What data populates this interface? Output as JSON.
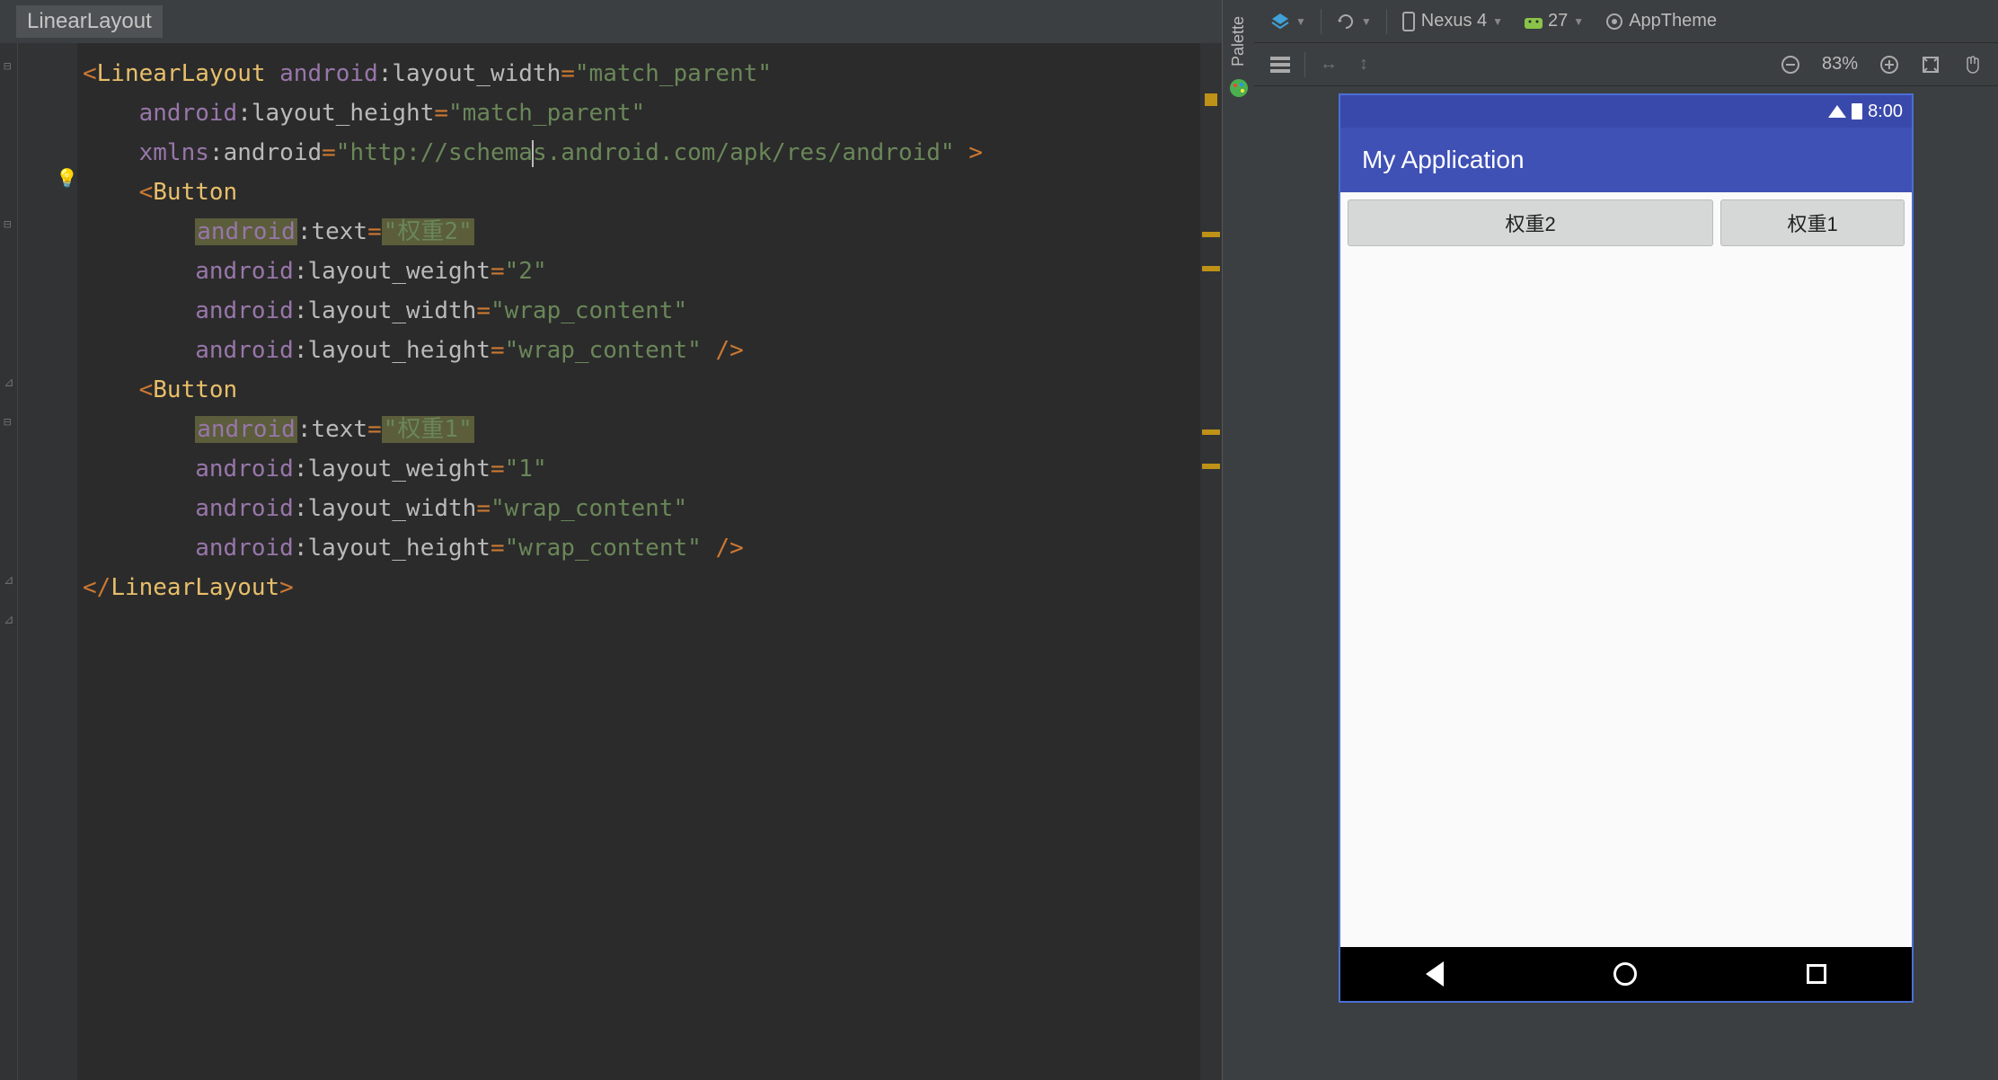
{
  "breadcrumb": {
    "item": "LinearLayout"
  },
  "code": {
    "root_tag": "LinearLayout",
    "attrs": {
      "layout_width": {
        "ns": "android",
        "name": "layout_width",
        "value": "match_parent"
      },
      "layout_height": {
        "ns": "android",
        "name": "layout_height",
        "value": "match_parent"
      },
      "xmlns": {
        "ns": "xmlns",
        "name": "android",
        "value": "http://schemas.android.com/apk/res/android"
      }
    },
    "button1": {
      "tag": "Button",
      "text": {
        "ns": "android",
        "name": "text",
        "value": "权重2"
      },
      "weight": {
        "ns": "android",
        "name": "layout_weight",
        "value": "2"
      },
      "width": {
        "ns": "android",
        "name": "layout_width",
        "value": "wrap_content"
      },
      "height": {
        "ns": "android",
        "name": "layout_height",
        "value": "wrap_content"
      }
    },
    "button2": {
      "tag": "Button",
      "text": {
        "ns": "android",
        "name": "text",
        "value": "权重1"
      },
      "weight": {
        "ns": "android",
        "name": "layout_weight",
        "value": "1"
      },
      "width": {
        "ns": "android",
        "name": "layout_width",
        "value": "wrap_content"
      },
      "height": {
        "ns": "android",
        "name": "layout_height",
        "value": "wrap_content"
      }
    },
    "close_tag": "LinearLayout"
  },
  "palette": {
    "label": "Palette"
  },
  "toolbar": {
    "device": "Nexus 4",
    "api": "27",
    "theme": "AppTheme"
  },
  "toolbar2": {
    "zoom": "83%"
  },
  "preview": {
    "status_time": "8:00",
    "app_title": "My Application",
    "btn1": "权重2",
    "btn2": "权重1"
  }
}
